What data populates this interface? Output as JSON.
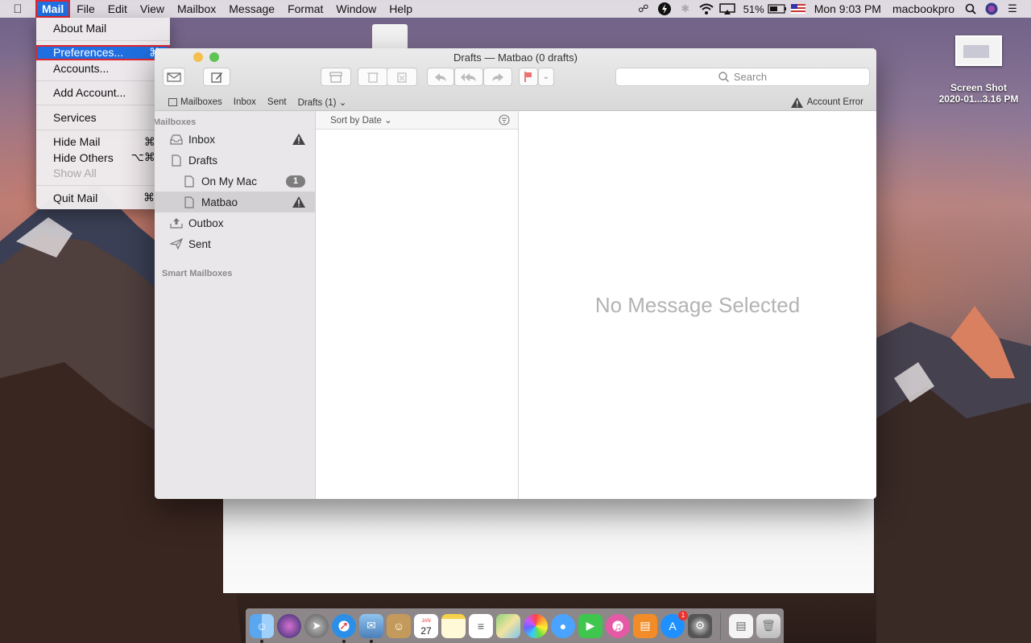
{
  "menubar": {
    "app_name": "Mail",
    "menus": [
      "File",
      "Edit",
      "View",
      "Mailbox",
      "Message",
      "Format",
      "Window",
      "Help"
    ],
    "battery": "51%",
    "clock": "Mon 9:03 PM",
    "user": "macbookpro"
  },
  "mail_menu": {
    "about": "About Mail",
    "preferences": "Preferences...",
    "preferences_shortcut": "⌘,",
    "accounts": "Accounts...",
    "add_account": "Add Account...",
    "services": "Services",
    "hide_mail": "Hide Mail",
    "hide_mail_shortcut": "⌘H",
    "hide_others": "Hide Others",
    "hide_others_shortcut": "⌥⌘H",
    "show_all": "Show All",
    "quit": "Quit Mail",
    "quit_shortcut": "⌘Q"
  },
  "window": {
    "title": "Drafts — Matbao (0 drafts)",
    "search_placeholder": "Search",
    "favorites": {
      "mailboxes": "Mailboxes",
      "inbox": "Inbox",
      "sent": "Sent",
      "drafts": "Drafts (1)",
      "account_error": "Account Error"
    },
    "sidebar": {
      "section_mailboxes": "Mailboxes",
      "inbox": "Inbox",
      "drafts": "Drafts",
      "on_my_mac": "On My Mac",
      "on_my_mac_count": "1",
      "matbao": "Matbao",
      "outbox": "Outbox",
      "sent": "Sent",
      "smart_mailboxes": "Smart Mailboxes"
    },
    "sort_label": "Sort by Date",
    "empty_preview": "No Message Selected"
  },
  "desktop": {
    "file_name_line1": "Screen Shot",
    "file_name_line2": "2020-01...3.16 PM"
  },
  "dock": {
    "calendar_month": "JAN",
    "calendar_day": "27",
    "app_store_badge": "1"
  }
}
